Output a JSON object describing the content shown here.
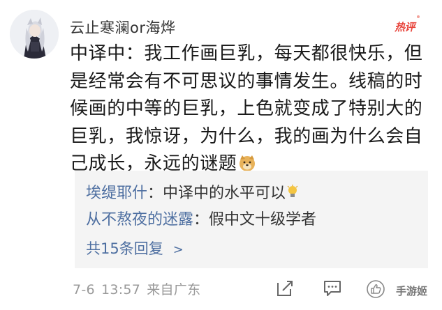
{
  "post": {
    "username": "云止寒澜or海烨",
    "hot_badge": "热评",
    "body": "中译中：我工作画巨乳，每天都很快乐，但是经常会有不可思议的事情发生。线稿的时候画的中等的巨乳，上色就变成了特别大的巨乳，我惊讶，为什么，我的画为什么会自己成长，永远的谜题",
    "avatar_icon": "anime-avatar",
    "emoji_icon": "doge-emoji"
  },
  "replies": {
    "items": [
      {
        "author": "埃缇耶什",
        "separator": "：",
        "text": "中译中的水平可以",
        "trailing_icon": "bulb-icon"
      },
      {
        "author": "从不熬夜的迷露",
        "separator": "：",
        "text": "假中文十级学者"
      }
    ],
    "more_label": "共15条回复",
    "more_chevron": ">"
  },
  "meta": {
    "date": "7-6",
    "time": "13:57",
    "source": "来自广东"
  },
  "actions": {
    "share_icon": "share-icon",
    "comment_icon": "comment-icon",
    "like_icon": "like-icon"
  },
  "watermark": {
    "text": "手游姬"
  },
  "colors": {
    "link_blue": "#4e6fa1",
    "hot_red": "#e8453c",
    "meta_gray": "#999999",
    "reply_bg": "#f4f4f4"
  }
}
